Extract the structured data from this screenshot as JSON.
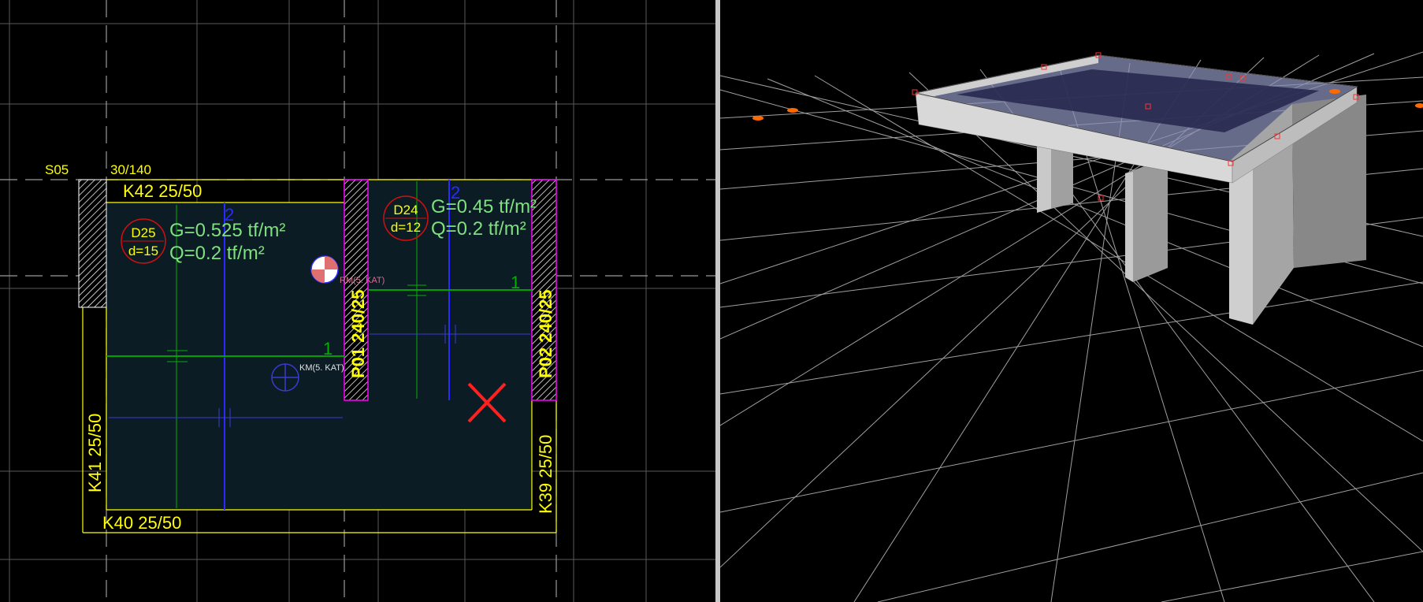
{
  "plan": {
    "column_tag": "S05",
    "column_size": "30/140",
    "beams": {
      "top": "K42 25/50",
      "left": "K41 25/50",
      "bottom": "K40 25/50",
      "right": "K39 25/50"
    },
    "walls": {
      "p01": "P01 240/25",
      "p02": "P02 240/25"
    },
    "slab_d25": {
      "id": "D25",
      "thickness": "d=15",
      "dead_load": "G=0.525 tf/m²",
      "live_load": "Q=0.2 tf/m²",
      "axis_x": "1",
      "axis_y": "2"
    },
    "slab_d24": {
      "id": "D24",
      "thickness": "d=12",
      "dead_load": "G=0.45 tf/m²",
      "live_load": "Q=0.2 tf/m²",
      "axis_x": "1",
      "axis_y": "2"
    },
    "marker_rm": "RM(5. KAT)",
    "marker_km": "KM(5. KAT)"
  },
  "colors": {
    "beam_line": "#ffff00",
    "slab_text": "#7ee07e",
    "slab_fill": "#0b1c24",
    "wall_border": "#ff00ff",
    "axis_blue": "#2a2aff",
    "axis_green": "#00c000",
    "delete_mark": "#ff2020",
    "grid": "#8a8a8a"
  }
}
